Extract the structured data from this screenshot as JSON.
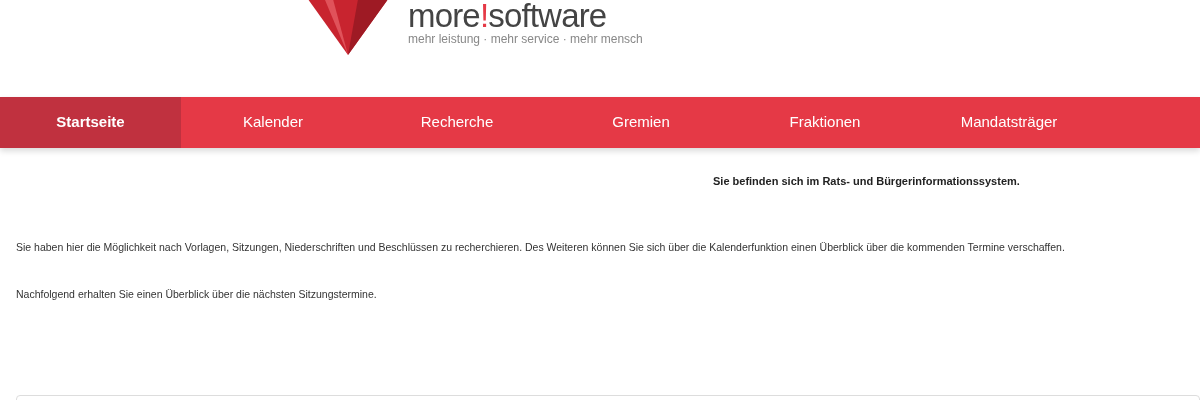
{
  "logo": {
    "name_parts": [
      {
        "text": "more",
        "accent": false
      },
      {
        "text": "!",
        "accent": true
      },
      {
        "text": "software",
        "accent": false
      }
    ],
    "tagline": "mehr leistung · mehr service · mehr mensch"
  },
  "nav": [
    {
      "label": "Startseite",
      "selected": true
    },
    {
      "label": "Kalender",
      "selected": false
    },
    {
      "label": "Recherche",
      "selected": false
    },
    {
      "label": "Gremien",
      "selected": false
    },
    {
      "label": "Fraktionen",
      "selected": false
    },
    {
      "label": "Mandatsträger",
      "selected": false
    }
  ],
  "heading": "Sie befinden sich im Rats- und Bürgerinformationssystem.",
  "paragraphs": [
    "Sie haben hier die Möglichkeit nach Vorlagen, Sitzungen, Niederschriften und Beschlüssen zu recherchieren. Des Weiteren können Sie sich über die Kalenderfunktion einen Überblick über die kommenden Termine verschaffen.",
    "Nachfolgend erhalten Sie einen Überblick über die nächsten Sitzungstermine."
  ]
}
